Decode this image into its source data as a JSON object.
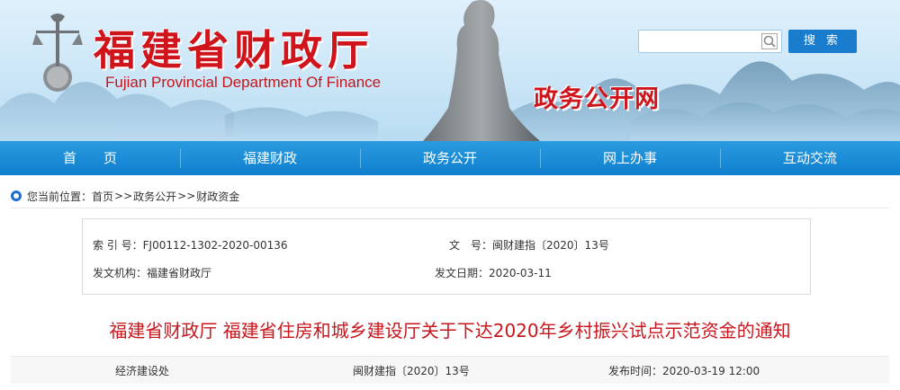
{
  "header": {
    "title_zh": "福建省财政厅",
    "title_en": "Fujian Provincial Department Of Finance",
    "subtitle": "政务公开网",
    "search": {
      "placeholder": "",
      "button_label": "搜 索"
    }
  },
  "nav": {
    "items": [
      {
        "label": "首　　页"
      },
      {
        "label": "福建财政"
      },
      {
        "label": "政务公开"
      },
      {
        "label": "网上办事"
      },
      {
        "label": "互动交流"
      }
    ]
  },
  "breadcrumb": {
    "prefix": "您当前位置：",
    "items": [
      "首页",
      "政务公开",
      "财政资金"
    ],
    "separator": ">>"
  },
  "info": {
    "index_label": "索 引 号：",
    "index_value": "FJ00112-1302-2020-00136",
    "docno_label": "文　号：",
    "docno_value": "闽财建指〔2020〕13号",
    "org_label": "发文机构：",
    "org_value": "福建省财政厅",
    "date_label": "发文日期：",
    "date_value": "2020-03-11"
  },
  "article": {
    "title": "福建省财政厅 福建省住房和城乡建设厅关于下达2020年乡村振兴试点示范资金的通知",
    "department": "经济建设处",
    "doc_number": "闽财建指〔2020〕13号",
    "publish_label": "发布时间：",
    "publish_time": "2020-03-19 12:00"
  },
  "colors": {
    "brand_red": "#d0141b",
    "nav_blue": "#1587d6",
    "button_blue": "#1a7ccc"
  }
}
